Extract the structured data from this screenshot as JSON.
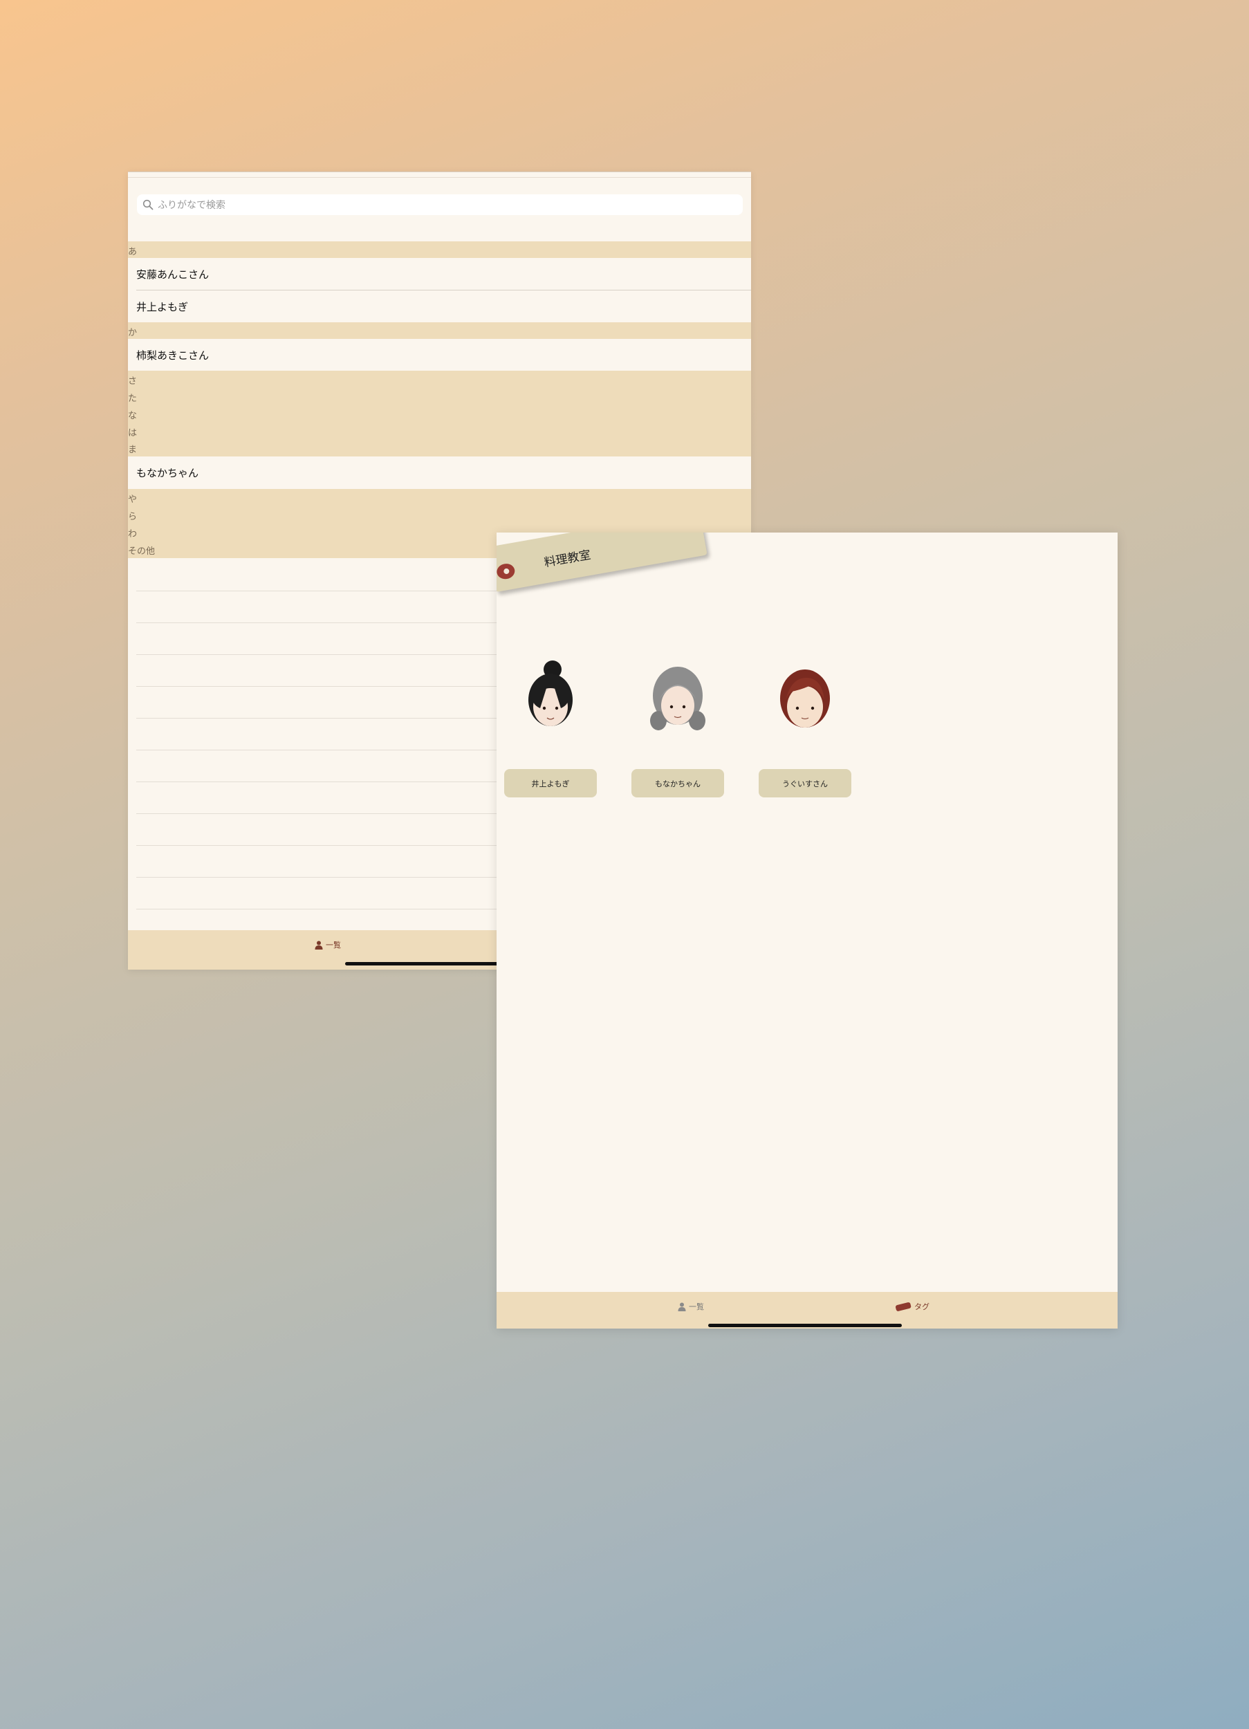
{
  "list_window": {
    "search": {
      "placeholder": "ふりがなで検索"
    },
    "sections": [
      {
        "kana": "あ",
        "rows": [
          "安藤あんこさん",
          "井上よもぎ"
        ]
      },
      {
        "kana": "か",
        "rows": [
          "柿梨あきこさん"
        ]
      },
      {
        "kana": "さ",
        "rows": []
      },
      {
        "kana": "た",
        "rows": []
      },
      {
        "kana": "な",
        "rows": []
      },
      {
        "kana": "は",
        "rows": []
      },
      {
        "kana": "ま",
        "rows": [
          "もなかちゃん"
        ]
      },
      {
        "kana": "や",
        "rows": []
      },
      {
        "kana": "ら",
        "rows": []
      },
      {
        "kana": "わ",
        "rows": []
      },
      {
        "kana": "その他",
        "rows": []
      }
    ],
    "tabbar": {
      "list_label": "一覧"
    }
  },
  "tag_window": {
    "tag_title": "料理教室",
    "members": [
      {
        "name": "井上よもぎ",
        "avatar": "black-bun-hair-avatar"
      },
      {
        "name": "もなかちゃん",
        "avatar": "gray-wavy-hair-avatar"
      },
      {
        "name": "うぐいすさん",
        "avatar": "auburn-bob-hair-avatar"
      }
    ],
    "tabbar": {
      "list_label": "一覧",
      "tag_label": "タグ"
    }
  },
  "colors": {
    "section_bg": "#eedcba",
    "row_bg": "#fbf6ee",
    "tag_bg": "#ddd4b3",
    "accent": "#9b3b32"
  }
}
